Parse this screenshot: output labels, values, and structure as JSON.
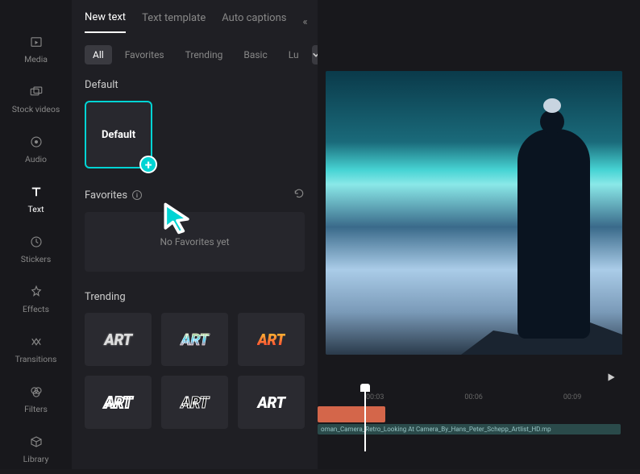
{
  "sidebar": {
    "items": [
      {
        "label": "Media",
        "icon": "media"
      },
      {
        "label": "Stock videos",
        "icon": "stock"
      },
      {
        "label": "Audio",
        "icon": "audio"
      },
      {
        "label": "Text",
        "icon": "text",
        "active": true
      },
      {
        "label": "Stickers",
        "icon": "stickers"
      },
      {
        "label": "Effects",
        "icon": "effects"
      },
      {
        "label": "Transitions",
        "icon": "transitions"
      },
      {
        "label": "Filters",
        "icon": "filters"
      },
      {
        "label": "Library",
        "icon": "library"
      }
    ]
  },
  "tabs": {
    "items": [
      "New text",
      "Text template",
      "Auto captions"
    ],
    "active": "New text",
    "overflow_glyph": "«"
  },
  "filters": {
    "items": [
      "All",
      "Favorites",
      "Trending",
      "Basic",
      "Lu"
    ],
    "active": "All"
  },
  "sections": {
    "default_title": "Default",
    "default_item_label": "Default",
    "favorites_title": "Favorites",
    "favorites_empty": "No Favorites yet",
    "trending_title": "Trending"
  },
  "trending": {
    "row1": [
      "ART",
      "ART",
      "ART"
    ],
    "row2": [
      "ART",
      "ART",
      "ART"
    ]
  },
  "timeline": {
    "marks": [
      "00:03",
      "00:06",
      "00:09"
    ],
    "clip_label": "oman_Camera_Retro_Looking At Camera_By_Hans_Peter_Schepp_Artlist_HD.mp"
  },
  "add_glyph": "+",
  "info_glyph": "i"
}
